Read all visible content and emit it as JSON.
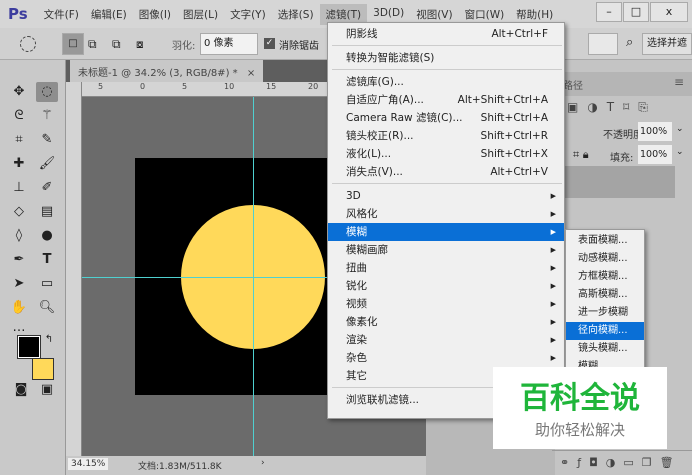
{
  "app": {
    "logo": "Ps"
  },
  "menubar": [
    "文件(F)",
    "编辑(E)",
    "图像(I)",
    "图层(L)",
    "文字(Y)",
    "选择(S)",
    "滤镜(T)",
    "3D(D)",
    "视图(V)",
    "窗口(W)",
    "帮助(H)"
  ],
  "window_controls": {
    "minimize": "–",
    "maximize": "□",
    "close": "x"
  },
  "options": {
    "feather_label": "羽化:",
    "feather_value": "0 像素",
    "antialias_label": "消除锯齿",
    "antialias_checked": true,
    "select_mask": "选择并遮"
  },
  "document": {
    "tab_title": "未标题-1 @ 34.2% (3, RGB/8#) *",
    "close": "×",
    "ruler_ticks": [
      "5",
      "0",
      "5",
      "10",
      "15",
      "20"
    ],
    "zoom": "34.15%",
    "doc_info": "文档:1.83M/511.8K",
    "arrow": "›"
  },
  "canvas": {
    "background": "#000000",
    "circle_color": "#ffd95a",
    "guide_color": "#4fd0d0"
  },
  "colors": {
    "foreground": "#000000",
    "background": "#ffd95a",
    "accent": "#0a6fd6"
  },
  "filter_menu": {
    "groups": [
      [
        {
          "label": "阴影线",
          "shortcut": "Alt+Ctrl+F"
        }
      ],
      [
        {
          "label": "转换为智能滤镜(S)"
        }
      ],
      [
        {
          "label": "滤镜库(G)..."
        },
        {
          "label": "自适应广角(A)...",
          "shortcut": "Alt+Shift+Ctrl+A"
        },
        {
          "label": "Camera Raw 滤镜(C)...",
          "shortcut": "Shift+Ctrl+A"
        },
        {
          "label": "镜头校正(R)...",
          "shortcut": "Shift+Ctrl+R"
        },
        {
          "label": "液化(L)...",
          "shortcut": "Shift+Ctrl+X"
        },
        {
          "label": "消失点(V)...",
          "shortcut": "Alt+Ctrl+V"
        }
      ],
      [
        {
          "label": "3D",
          "sub": true
        },
        {
          "label": "风格化",
          "sub": true
        },
        {
          "label": "模糊",
          "sub": true,
          "highlighted": true
        },
        {
          "label": "模糊画廊",
          "sub": true
        },
        {
          "label": "扭曲",
          "sub": true
        },
        {
          "label": "锐化",
          "sub": true
        },
        {
          "label": "视频",
          "sub": true
        },
        {
          "label": "像素化",
          "sub": true
        },
        {
          "label": "渲染",
          "sub": true
        },
        {
          "label": "杂色",
          "sub": true
        },
        {
          "label": "其它",
          "sub": true
        }
      ],
      [
        {
          "label": "浏览联机滤镜..."
        }
      ]
    ]
  },
  "blur_submenu": [
    {
      "label": "表面模糊..."
    },
    {
      "label": "动感模糊..."
    },
    {
      "label": "方框模糊..."
    },
    {
      "label": "高斯模糊..."
    },
    {
      "label": "进一步模糊"
    },
    {
      "label": "径向模糊...",
      "highlighted": true
    },
    {
      "label": "镜头模糊..."
    },
    {
      "label": "模糊"
    }
  ],
  "layers_panel": {
    "tab": "路径",
    "opacity_label": "不透明度:",
    "opacity_value": "100%",
    "fill_label": "填充:",
    "fill_value": "100%"
  },
  "watermark": {
    "title": "百科全说",
    "subtitle": "助你轻松解决"
  }
}
